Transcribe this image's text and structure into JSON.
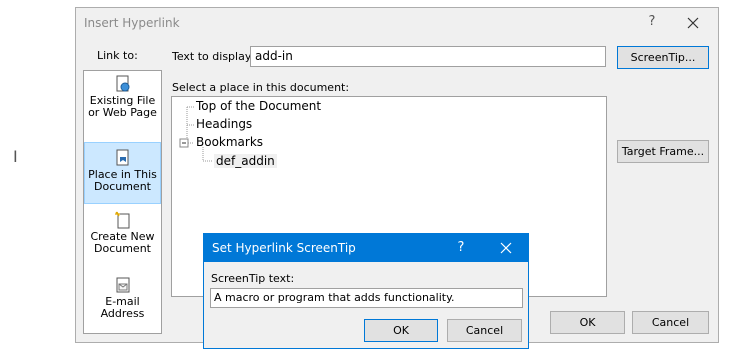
{
  "dialog": {
    "title": "Insert Hyperlink",
    "help": "?",
    "close_icon": "close-icon",
    "link_to_label": "Link to:",
    "link_to_items": [
      {
        "label": "Existing File or Web Page",
        "icon": "globe-file-icon"
      },
      {
        "label": "Place in This Document",
        "icon": "document-bookmark-icon",
        "selected": true
      },
      {
        "label": "Create New Document",
        "icon": "new-document-icon"
      },
      {
        "label": "E-mail Address",
        "icon": "email-icon"
      }
    ],
    "text_to_display_label": "Text to display:",
    "text_to_display_value": "add-in",
    "screentip_button": "ScreenTip...",
    "select_place_label": "Select a place in this document:",
    "tree": {
      "items": [
        "Top of the Document",
        "Headings",
        "Bookmarks",
        "def_addin"
      ]
    },
    "target_frame_button": "Target Frame...",
    "ok_button": "OK",
    "cancel_button": "Cancel"
  },
  "screentip_dialog": {
    "title": "Set Hyperlink ScreenTip",
    "help": "?",
    "label": "ScreenTip text:",
    "value": "A macro or program that adds functionality.",
    "ok_button": "OK",
    "cancel_button": "Cancel"
  },
  "colors": {
    "accent": "#0078d7",
    "selection": "#cce8ff",
    "dialog_bg": "#f0f0f0"
  }
}
